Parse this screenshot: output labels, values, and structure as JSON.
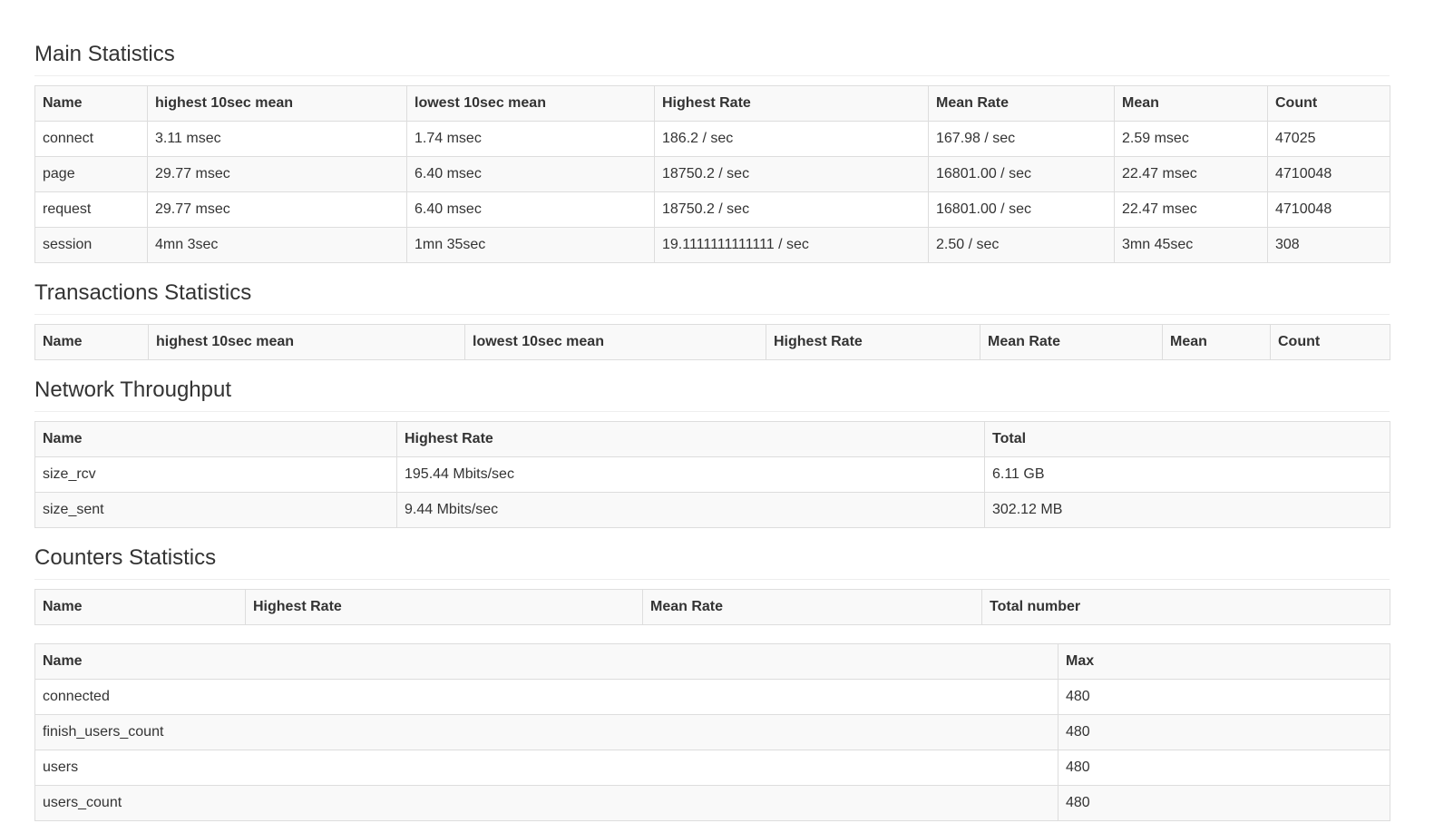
{
  "main": {
    "title": "Main Statistics",
    "headers": [
      "Name",
      "highest 10sec mean",
      "lowest 10sec mean",
      "Highest Rate",
      "Mean Rate",
      "Mean",
      "Count"
    ],
    "rows": [
      [
        "connect",
        "3.11 msec",
        "1.74 msec",
        "186.2 / sec",
        "167.98 / sec",
        "2.59 msec",
        "47025"
      ],
      [
        "page",
        "29.77 msec",
        "6.40 msec",
        "18750.2 / sec",
        "16801.00 / sec",
        "22.47 msec",
        "4710048"
      ],
      [
        "request",
        "29.77 msec",
        "6.40 msec",
        "18750.2 / sec",
        "16801.00 / sec",
        "22.47 msec",
        "4710048"
      ],
      [
        "session",
        "4mn 3sec",
        "1mn 35sec",
        "19.1111111111111 / sec",
        "2.50 / sec",
        "3mn 45sec",
        "308"
      ]
    ]
  },
  "transactions": {
    "title": "Transactions Statistics",
    "headers": [
      "Name",
      "highest 10sec mean",
      "lowest 10sec mean",
      "Highest Rate",
      "Mean Rate",
      "Mean",
      "Count"
    ]
  },
  "network": {
    "title": "Network Throughput",
    "headers": [
      "Name",
      "Highest Rate",
      "Total"
    ],
    "rows": [
      [
        "size_rcv",
        "195.44 Mbits/sec",
        "6.11 GB"
      ],
      [
        "size_sent",
        "9.44 Mbits/sec",
        "302.12 MB"
      ]
    ]
  },
  "counters": {
    "title": "Counters Statistics",
    "headers": [
      "Name",
      "Highest Rate",
      "Mean Rate",
      "Total number"
    ],
    "max_headers": [
      "Name",
      "Max"
    ],
    "max_rows": [
      [
        "connected",
        "480"
      ],
      [
        "finish_users_count",
        "480"
      ],
      [
        "users",
        "480"
      ],
      [
        "users_count",
        "480"
      ]
    ]
  }
}
